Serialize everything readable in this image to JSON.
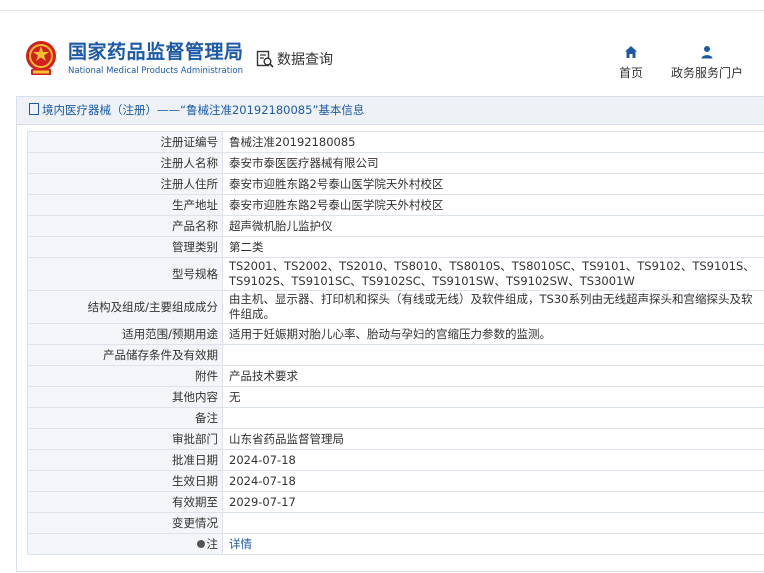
{
  "header": {
    "agency_name_cn": "国家药品监督管理局",
    "agency_name_en": "National Medical Products Administration",
    "query_label": "数据查询",
    "nav_home": "首页",
    "nav_portal": "政务服务门户"
  },
  "panel": {
    "title": "境内医疗器械（注册）——“鲁械注准20192180085”基本信息"
  },
  "fields": [
    {
      "label": "注册证编号",
      "value": "鲁械注准20192180085"
    },
    {
      "label": "注册人名称",
      "value": "泰安市泰医医疗器械有限公司"
    },
    {
      "label": "注册人住所",
      "value": "泰安市迎胜东路2号泰山医学院天外村校区"
    },
    {
      "label": "生产地址",
      "value": "泰安市迎胜东路2号泰山医学院天外村校区"
    },
    {
      "label": "产品名称",
      "value": "超声微机胎儿监护仪"
    },
    {
      "label": "管理类别",
      "value": "第二类"
    },
    {
      "label": "型号规格",
      "value": "TS2001、TS2002、TS2010、TS8010、TS8010S、TS8010SC、TS9101、TS9102、TS9101S、TS9102S、TS9101SC、TS9102SC、TS9101SW、TS9102SW、TS3001W"
    },
    {
      "label": "结构及组成/主要组成成分",
      "value": "由主机、显示器、打印机和探头（有线或无线）及软件组成，TS30系列由无线超声探头和宫缩探头及软件组成。"
    },
    {
      "label": "适用范围/预期用途",
      "value": "适用于妊娠期对胎儿心率、胎动与孕妇的宫缩压力参数的监测。"
    },
    {
      "label": "产品储存条件及有效期",
      "value": ""
    },
    {
      "label": "附件",
      "value": "产品技术要求"
    },
    {
      "label": "其他内容",
      "value": "无"
    },
    {
      "label": "备注",
      "value": ""
    },
    {
      "label": "审批部门",
      "value": "山东省药品监督管理局"
    },
    {
      "label": "批准日期",
      "value": "2024-07-18"
    },
    {
      "label": "生效日期",
      "value": "2024-07-18"
    },
    {
      "label": "有效期至",
      "value": "2029-07-17"
    },
    {
      "label": "变更情况",
      "value": ""
    },
    {
      "label": "注",
      "value": "详情"
    }
  ]
}
